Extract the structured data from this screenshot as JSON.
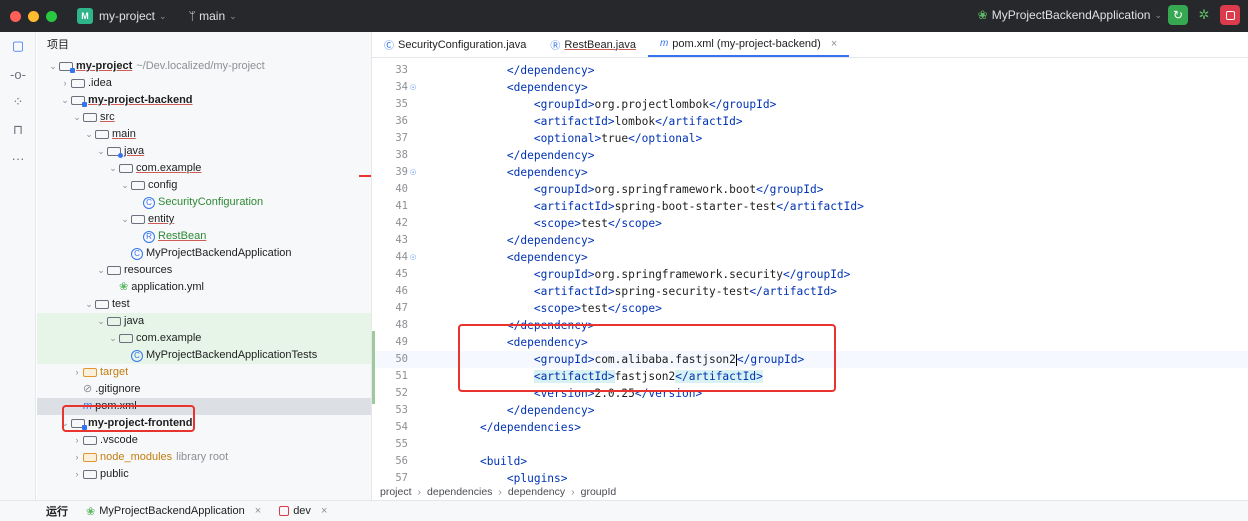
{
  "titlebar": {
    "project_badge": "M",
    "project_name": "my-project",
    "branch_icon": "git-branch-icon",
    "branch": "main",
    "run_config": "MyProjectBackendApplication"
  },
  "project_tree": {
    "title": "项目",
    "rows": [
      {
        "label": "my-project",
        "extra": "~/Dev.localized/my-project"
      },
      {
        "label": ".idea"
      },
      {
        "label": "my-project-backend"
      },
      {
        "label": "src"
      },
      {
        "label": "main"
      },
      {
        "label": "java"
      },
      {
        "label": "com.example"
      },
      {
        "label": "config"
      },
      {
        "label": "SecurityConfiguration"
      },
      {
        "label": "entity"
      },
      {
        "label": "RestBean"
      },
      {
        "label": "MyProjectBackendApplication"
      },
      {
        "label": "resources"
      },
      {
        "label": "application.yml"
      },
      {
        "label": "test"
      },
      {
        "label": "java"
      },
      {
        "label": "com.example"
      },
      {
        "label": "MyProjectBackendApplicationTests"
      },
      {
        "label": "target"
      },
      {
        "label": ".gitignore"
      },
      {
        "label": "pom.xml"
      },
      {
        "label": "my-project-frontend"
      },
      {
        "label": ".vscode"
      },
      {
        "label": "node_modules",
        "extra": "library root"
      },
      {
        "label": "public"
      }
    ]
  },
  "tabs": [
    {
      "label": "SecurityConfiguration.java"
    },
    {
      "label": "RestBean.java"
    },
    {
      "label": "pom.xml (my-project-backend)"
    }
  ],
  "code_lines": [
    {
      "n": "33",
      "pre": "        ",
      "a": "</dependency>"
    },
    {
      "n": "34",
      "pre": "        ",
      "a": "<dependency>"
    },
    {
      "n": "35",
      "pre": "            ",
      "a": "<groupId>",
      "t": "org.projectlombok",
      "b": "</groupId>"
    },
    {
      "n": "36",
      "pre": "            ",
      "a": "<artifactId>",
      "t": "lombok",
      "b": "</artifactId>"
    },
    {
      "n": "37",
      "pre": "            ",
      "a": "<optional>",
      "t": "true",
      "b": "</optional>"
    },
    {
      "n": "38",
      "pre": "        ",
      "a": "</dependency>"
    },
    {
      "n": "39",
      "pre": "        ",
      "a": "<dependency>"
    },
    {
      "n": "40",
      "pre": "            ",
      "a": "<groupId>",
      "t": "org.springframework.boot",
      "b": "</groupId>"
    },
    {
      "n": "41",
      "pre": "            ",
      "a": "<artifactId>",
      "t": "spring-boot-starter-test",
      "b": "</artifactId>"
    },
    {
      "n": "42",
      "pre": "            ",
      "a": "<scope>",
      "t": "test",
      "b": "</scope>"
    },
    {
      "n": "43",
      "pre": "        ",
      "a": "</dependency>"
    },
    {
      "n": "44",
      "pre": "        ",
      "a": "<dependency>"
    },
    {
      "n": "45",
      "pre": "            ",
      "a": "<groupId>",
      "t": "org.springframework.security",
      "b": "</groupId>"
    },
    {
      "n": "46",
      "pre": "            ",
      "a": "<artifactId>",
      "t": "spring-security-test",
      "b": "</artifactId>"
    },
    {
      "n": "47",
      "pre": "            ",
      "a": "<scope>",
      "t": "test",
      "b": "</scope>"
    },
    {
      "n": "48",
      "pre": "        ",
      "a": "</dependency>"
    },
    {
      "n": "49",
      "pre": "        ",
      "a": "<dependency>"
    },
    {
      "n": "50",
      "pre": "            ",
      "a": "<groupId>",
      "t": "com.alibaba.fastjson2",
      "b": "</groupId>"
    },
    {
      "n": "51",
      "pre": "            ",
      "a": "<artifactId>",
      "t": "fastjson2",
      "b": "</artifactId>"
    },
    {
      "n": "52",
      "pre": "            ",
      "a": "<version>",
      "t": "2.0.25",
      "b": "</version>"
    },
    {
      "n": "53",
      "pre": "        ",
      "a": "</dependency>"
    },
    {
      "n": "54",
      "pre": "    ",
      "a": "</dependencies>"
    },
    {
      "n": "55",
      "pre": "",
      "a": ""
    },
    {
      "n": "56",
      "pre": "    ",
      "a": "<build>"
    },
    {
      "n": "57",
      "pre": "        ",
      "a": "<plugins>"
    }
  ],
  "breadcrumb": [
    "project",
    "dependencies",
    "dependency",
    "groupId"
  ],
  "bottom": {
    "label": "运行",
    "tab1": "MyProjectBackendApplication",
    "tab2": "dev"
  },
  "colors": {
    "accent": "#3574f0",
    "annotation_box": "#e8332e",
    "run_green": "#37a852",
    "stop_red": "#db3b4b"
  }
}
